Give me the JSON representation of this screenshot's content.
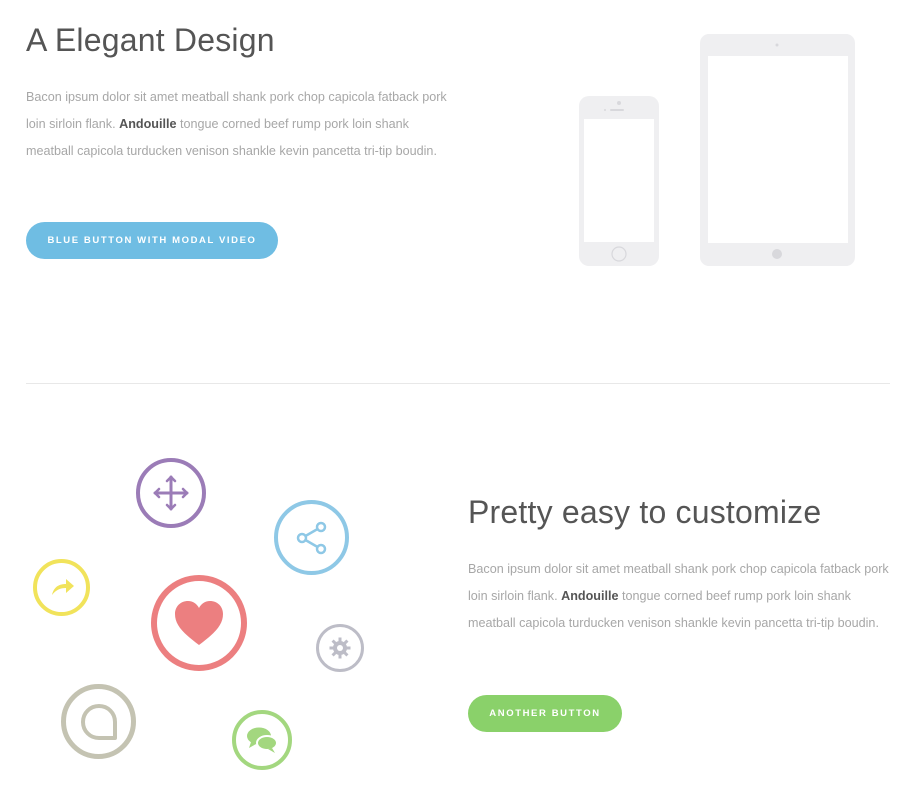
{
  "section1": {
    "title": "A Elegant Design",
    "text_before": "Bacon ipsum dolor sit amet meatball shank pork chop capicola fatback pork loin sirloin flank. ",
    "bold": "Andouille",
    "text_after": " tongue corned beef rump pork loin shank meatball capicola turducken venison shankle kevin pancetta tri-tip boudin.",
    "button_label": "Blue Button with Modal Video",
    "button_color": "#6fbde3"
  },
  "section2": {
    "title": "Pretty easy to customize",
    "text_before": "Bacon ipsum dolor sit amet meatball shank pork chop capicola fatback pork loin sirloin flank. ",
    "bold": "Andouille",
    "text_after": " tongue corned beef rump pork loin shank meatball capicola turducken venison shankle kevin pancetta tri-tip boudin.",
    "button_label": "Another Button",
    "button_color": "#8ad16a"
  },
  "icons": [
    {
      "name": "move-icon",
      "color": "#9b7cb7"
    },
    {
      "name": "share-icon",
      "color": "#8ec8e6"
    },
    {
      "name": "forward-icon",
      "color": "#f1e35b"
    },
    {
      "name": "heart-icon",
      "color": "#ec7f80"
    },
    {
      "name": "gear-icon",
      "color": "#bdbdc7"
    },
    {
      "name": "chat-bubble-icon",
      "color": "#c4c3b2"
    },
    {
      "name": "speech-bubbles-icon",
      "color": "#a3d77f"
    }
  ],
  "device_color": "#efeff1"
}
